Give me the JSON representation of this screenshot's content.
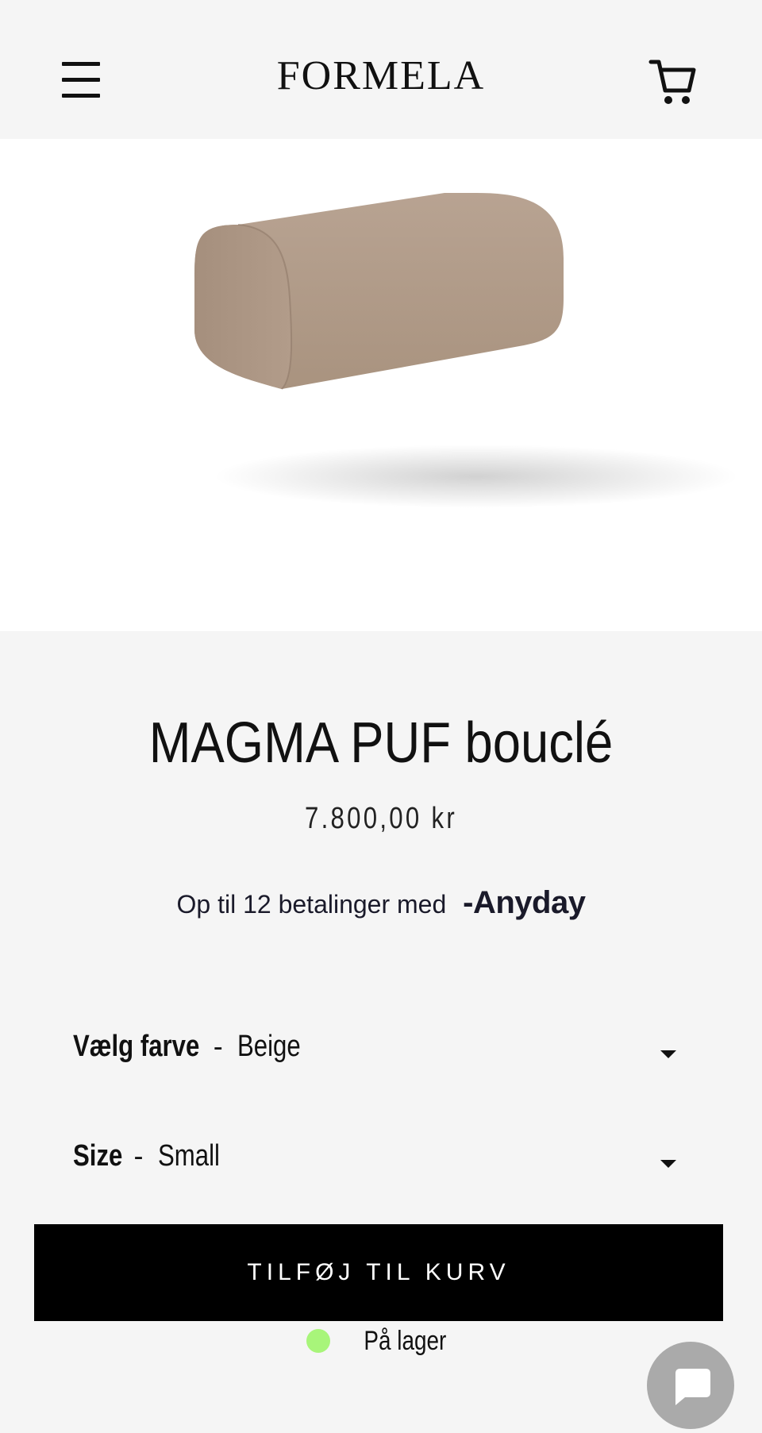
{
  "header": {
    "logo_text": "FORMELA",
    "menu_icon": "hamburger-menu-icon",
    "cart_icon": "shopping-cart-icon"
  },
  "product": {
    "title": "MAGMA PUF bouclé",
    "price": "7.800,00 kr",
    "image_alt": "Beige bouclé pouf"
  },
  "payment": {
    "text": "Op til 12 betalinger med",
    "brand": "Anyday"
  },
  "options": {
    "color": {
      "label": "Vælg farve",
      "separator": "-",
      "value": "Beige"
    },
    "size": {
      "label": "Size",
      "separator": "-",
      "value": "Small"
    }
  },
  "actions": {
    "add_to_cart_label": "TILFØJ TIL KURV"
  },
  "stock": {
    "text": "På lager",
    "indicator_color": "#a8f57a"
  },
  "chat": {
    "icon": "chat-bubble-icon"
  },
  "colors": {
    "background": "#f5f5f5",
    "button": "#000000",
    "chat_button": "#aaaaaa",
    "product": "#b09a8a"
  }
}
